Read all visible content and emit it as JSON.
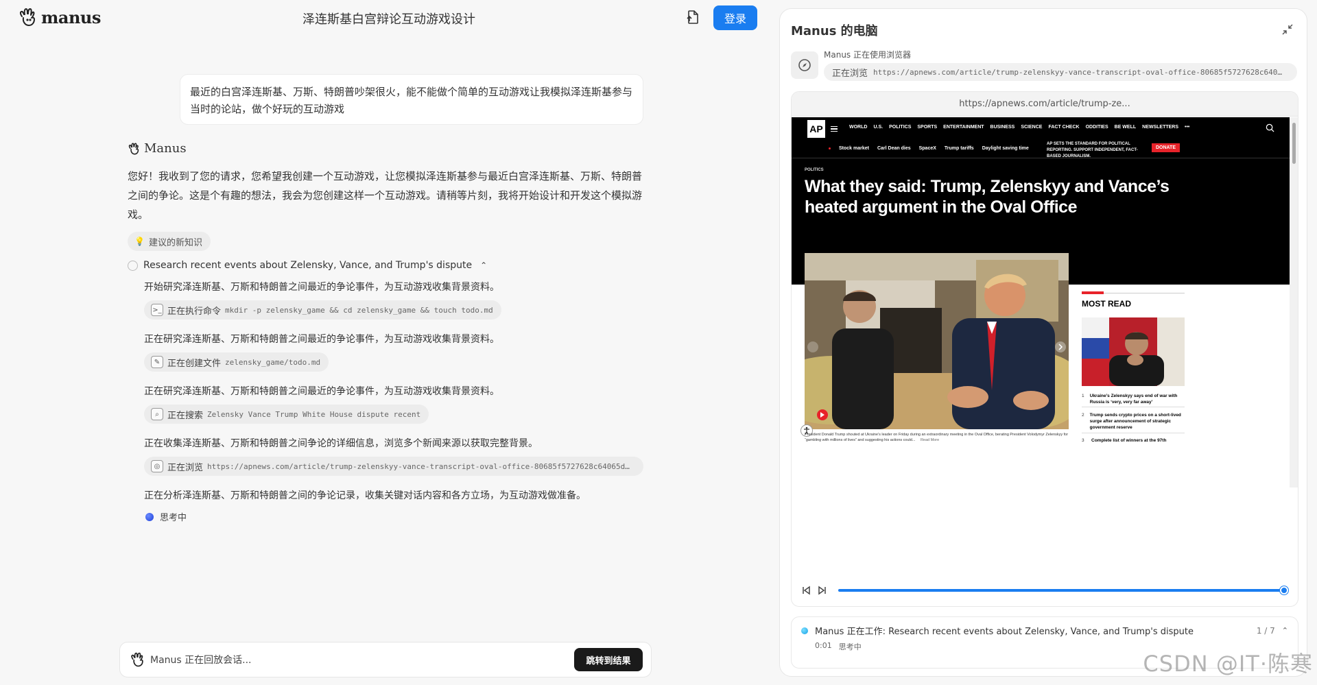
{
  "app": {
    "logo_text": "manus",
    "task_title": "泽连斯基白宫辩论互动游戏设计",
    "login_label": "登录"
  },
  "chat": {
    "user_message": "最近的白宫泽连斯基、万斯、特朗普吵架很火，能不能做个简单的互动游戏让我模拟泽连斯基参与当时的论站，做个好玩的互动游戏",
    "bot_name": "Manus",
    "bot_reply": "您好！我收到了您的请求，您希望我创建一个互动游戏，让您模拟泽连斯基参与最近白宫泽连斯基、万斯、特朗普之间的争论。这是个有趣的想法，我会为您创建这样一个互动游戏。请稍等片刻，我将开始设计和开发这个模拟游戏。",
    "knowledge_chip": "建议的新知识",
    "research_title": "Research recent events about Zelensky, Vance, and Trump's dispute",
    "steps": [
      {
        "text": "开始研究泽连斯基、万斯和特朗普之间最近的争论事件，为互动游戏收集背景资料。",
        "chip_verb": "正在执行命令",
        "chip_detail": "mkdir -p zelensky_game && cd zelensky_game && touch todo.md",
        "icon": "terminal-icon",
        "glyph": ">_"
      },
      {
        "text": "正在研究泽连斯基、万斯和特朗普之间最近的争论事件，为互动游戏收集背景资料。",
        "chip_verb": "正在创建文件",
        "chip_detail": "zelensky_game/todo.md",
        "icon": "edit-icon",
        "glyph": "✎"
      },
      {
        "text": "正在研究泽连斯基、万斯和特朗普之间最近的争论事件，为互动游戏收集背景资料。",
        "chip_verb": "正在搜索",
        "chip_detail": "Zelensky Vance Trump White House dispute recent",
        "icon": "search-icon",
        "glyph": "⌕"
      },
      {
        "text": "正在收集泽连斯基、万斯和特朗普之间争论的详细信息，浏览多个新闻来源以获取完整背景。",
        "chip_verb": "正在浏览",
        "chip_detail": "https://apnews.com/article/trump-zelenskyy-vance-transcript-oval-office-80685f5727628c64065d…",
        "icon": "compass-icon",
        "glyph": "◎"
      }
    ],
    "final_step": "正在分析泽连斯基、万斯和特朗普之间的争论记录，收集关键对话内容和各方立场，为互动游戏做准备。",
    "thinking": "思考中",
    "replay_text": "Manus 正在回放会话...",
    "jump_label": "跳转到结果"
  },
  "computer": {
    "title": "Manus 的电脑",
    "using_browser": "Manus 正在使用浏览器",
    "browsing_verb": "正在浏览",
    "browsing_url": "https://apnews.com/article/trump-zelenskyy-vance-transcript-oval-office-80685f5727628c640…",
    "url_bar": "https://apnews.com/article/trump-ze...",
    "progress": 1.0,
    "status_text": "Manus 正在工作: Research recent events about Zelensky, Vance, and Trump's dispute",
    "status_count": "1 / 7",
    "status_time": "0:01",
    "status_sub": "思考中"
  },
  "site": {
    "logo": "AP",
    "nav": [
      "WORLD",
      "U.S.",
      "POLITICS",
      "SPORTS",
      "ENTERTAINMENT",
      "BUSINESS",
      "SCIENCE",
      "FACT CHECK",
      "ODDITIES",
      "BE WELL",
      "NEWSLETTERS",
      "•••"
    ],
    "subnav": [
      "Stock market",
      "Carl Dean dies",
      "SpaceX",
      "Trump tariffs",
      "Daylight saving time"
    ],
    "ap_sets": "AP SETS THE STANDARD FOR POLITICAL REPORTING. SUPPORT INDEPENDENT, FACT-BASED JOURNALISM.",
    "donate": "DONATE",
    "section": "POLITICS",
    "headline": "What they said: Trump, Zelenskyy and Vance’s heated argument in the Oval Office",
    "caption": "President Donald Trump shouted at Ukraine’s leader on Friday during an extraordinary meeting in the Oval Office, berating President Volodymyr Zelenskyy for “gambling with millions of lives” and suggesting his actions could...",
    "read_more": "Read More",
    "most_read_title": "MOST READ",
    "most_read": [
      {
        "n": "1",
        "text": "Ukraine’s Zelenskyy says end of war with Russia is ‘very, very far away’"
      },
      {
        "n": "2",
        "text": "Trump sends crypto prices on a short-lived surge after announcement of strategic government reserve"
      },
      {
        "n": "3",
        "text": "Complete list of winners at the 97th"
      }
    ]
  },
  "watermark": "CSDN @IT·陈寒"
}
